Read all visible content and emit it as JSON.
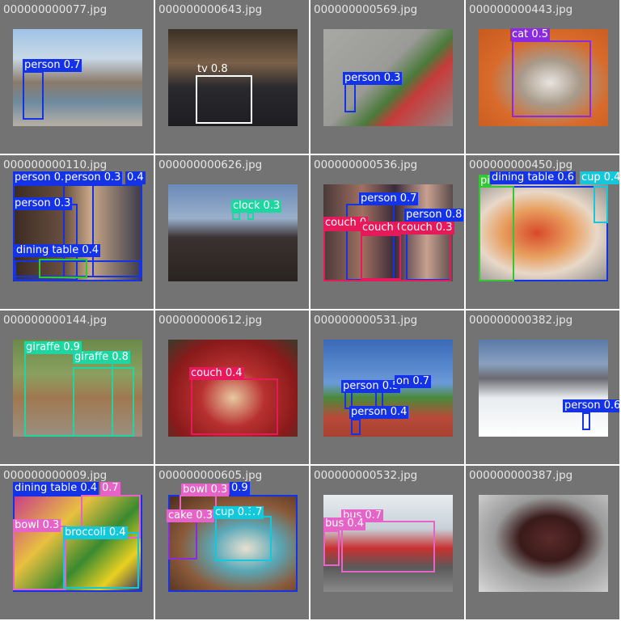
{
  "colors": {
    "background": "#737373",
    "filename_text": "#e6e6e6",
    "person": "#1433e6",
    "tv": "#ffffff",
    "cat": "#8a2be2",
    "clock": "#1fd6a0",
    "couch": "#e6195a",
    "pizza": "#32c832",
    "dining_table": "#1433e6",
    "cup": "#14c8dc",
    "giraffe": "#1fd6a0",
    "bowl": "#e664c8",
    "broccoli": "#14c8dc",
    "cake": "#e664c8",
    "bus": "#e664c8"
  },
  "tiles": [
    {
      "filename": "000000000077.jpg",
      "detections": [
        {
          "label": "person 0.7",
          "color": "#1433e6"
        }
      ]
    },
    {
      "filename": "000000000643.jpg",
      "detections": [
        {
          "label": "tv 0.8",
          "color": "#ffffff"
        }
      ]
    },
    {
      "filename": "000000000569.jpg",
      "detections": [
        {
          "label": "person 0.3",
          "color": "#1433e6"
        }
      ]
    },
    {
      "filename": "000000000443.jpg",
      "detections": [
        {
          "label": "cat 0.5",
          "color": "#8a2be2"
        }
      ]
    },
    {
      "filename": "000000000110.jpg",
      "detections": [
        {
          "label": "person 0.",
          "color": "#1433e6"
        },
        {
          "label": "person 0.3",
          "color": "#1433e6"
        },
        {
          "label": "0.4",
          "color": "#1433e6"
        },
        {
          "label": "person 0.3",
          "color": "#1433e6"
        },
        {
          "label": "dining table 0.4",
          "color": "#1433e6"
        }
      ]
    },
    {
      "filename": "000000000626.jpg",
      "detections": [
        {
          "label": "clock 0.3",
          "color": "#1fd6a0"
        }
      ]
    },
    {
      "filename": "000000000536.jpg",
      "detections": [
        {
          "label": "person 0.7",
          "color": "#1433e6"
        },
        {
          "label": "person 0.8",
          "color": "#1433e6"
        },
        {
          "label": "couch 0",
          "color": "#e6195a"
        },
        {
          "label": "couch 0",
          "color": "#e6195a"
        },
        {
          "label": "couch 0.3",
          "color": "#e6195a"
        }
      ]
    },
    {
      "filename": "000000000450.jpg",
      "detections": [
        {
          "label": "dining table 0.6",
          "color": "#1433e6"
        },
        {
          "label": "cup 0.4",
          "color": "#14c8dc"
        },
        {
          "label": "pi",
          "color": "#32c832"
        }
      ]
    },
    {
      "filename": "000000000144.jpg",
      "detections": [
        {
          "label": "giraffe 0.9",
          "color": "#1fd6a0"
        },
        {
          "label": "giraffe 0.8",
          "color": "#1fd6a0"
        }
      ]
    },
    {
      "filename": "000000000612.jpg",
      "detections": [
        {
          "label": "couch 0.4",
          "color": "#e6195a"
        }
      ]
    },
    {
      "filename": "000000000531.jpg",
      "detections": [
        {
          "label": "person 0.5",
          "color": "#1433e6"
        },
        {
          "label": "on 0.7",
          "color": "#1433e6"
        },
        {
          "label": "person 0.4",
          "color": "#1433e6"
        }
      ]
    },
    {
      "filename": "000000000382.jpg",
      "detections": [
        {
          "label": "person 0.6",
          "color": "#1433e6"
        }
      ]
    },
    {
      "filename": "000000000009.jpg",
      "detections": [
        {
          "label": "dining table 0.4",
          "color": "#1433e6"
        },
        {
          "label": "0.7",
          "color": "#e664c8"
        },
        {
          "label": "bowl 0.3",
          "color": "#e664c8"
        },
        {
          "label": "broccoli 0.4",
          "color": "#14c8dc"
        }
      ]
    },
    {
      "filename": "000000000605.jpg",
      "detections": [
        {
          "label": "bowl 0.3",
          "color": "#e664c8"
        },
        {
          "label": "0.9",
          "color": "#1433e6"
        },
        {
          "label": "cake 0.3",
          "color": "#e664c8"
        },
        {
          "label": "cup 0.3",
          "color": "#14c8dc"
        },
        {
          "label": ".7",
          "color": "#14c8dc"
        }
      ]
    },
    {
      "filename": "000000000532.jpg",
      "detections": [
        {
          "label": "bus 0.7",
          "color": "#e664c8"
        },
        {
          "label": "bus 0.4",
          "color": "#e664c8"
        }
      ]
    },
    {
      "filename": "000000000387.jpg",
      "detections": []
    }
  ]
}
